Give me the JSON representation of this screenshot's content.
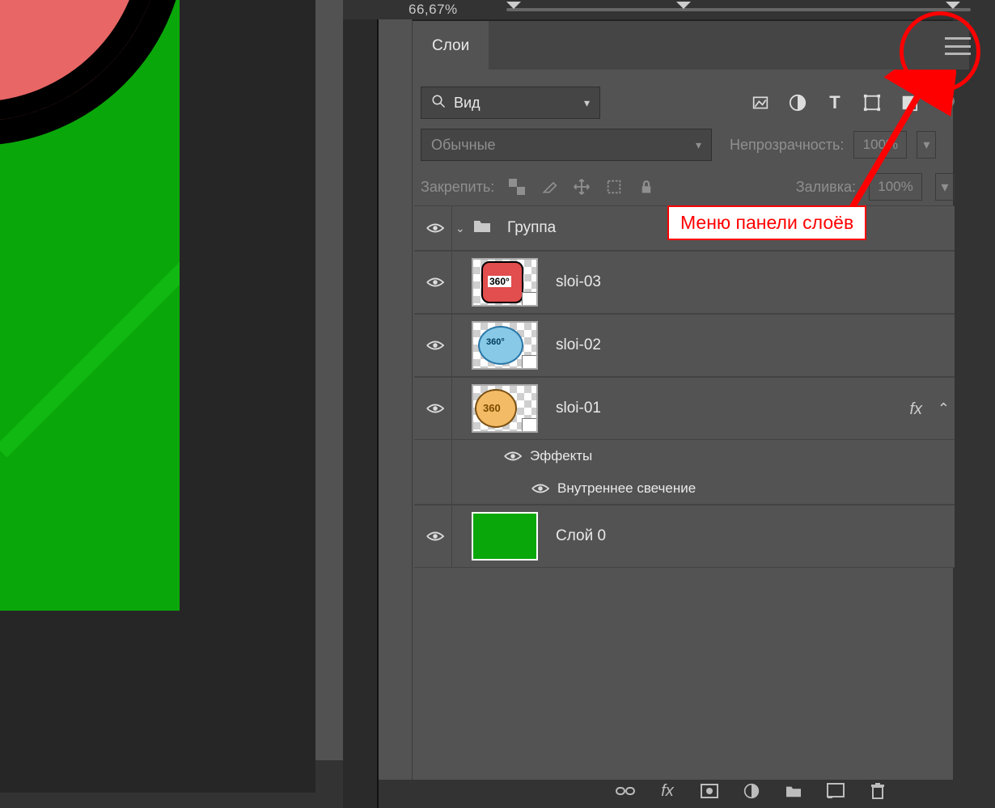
{
  "zoom": {
    "value": "66,67%"
  },
  "panel": {
    "tab": "Слои",
    "search": {
      "label": "Вид"
    },
    "blend_mode": "Обычные",
    "opacity": {
      "label": "Непрозрачность:",
      "value": "100%"
    },
    "lock": {
      "label": "Закрепить:"
    },
    "fill": {
      "label": "Заливка:",
      "value": "100%"
    }
  },
  "group": {
    "name": "Группа"
  },
  "layers": [
    {
      "name": "sloi-03"
    },
    {
      "name": "sloi-02"
    },
    {
      "name": "sloi-01",
      "fx": "fx"
    },
    {
      "name": "Слой 0"
    }
  ],
  "effects": {
    "title": "Эффекты",
    "items": [
      "Внутреннее свечение"
    ]
  },
  "annotation": "Меню панели слоёв"
}
